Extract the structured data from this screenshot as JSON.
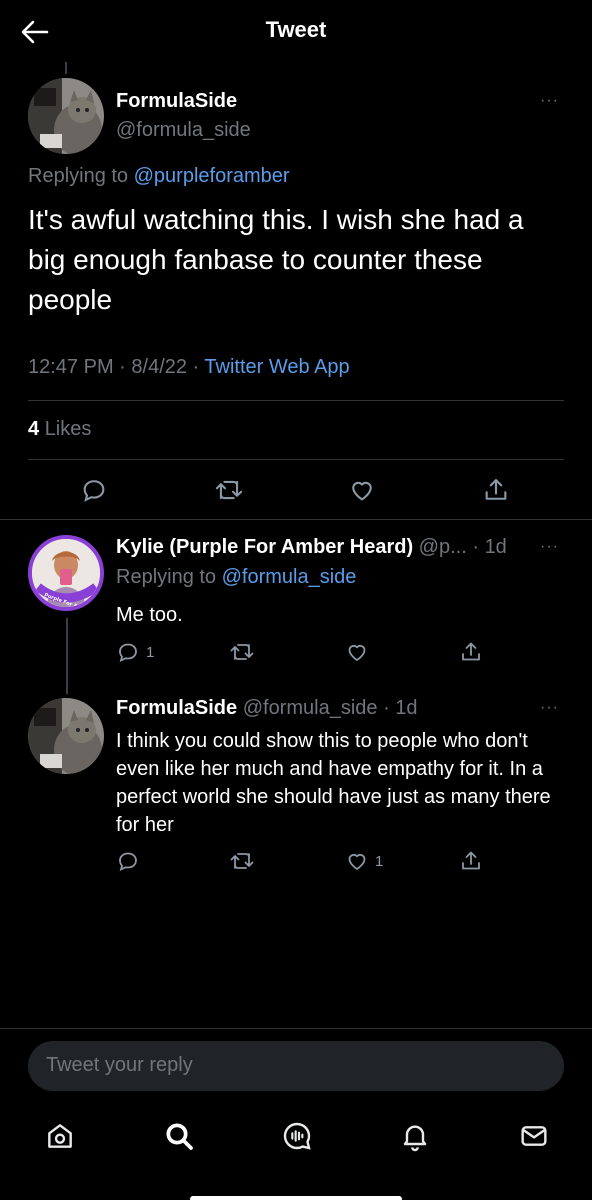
{
  "header": {
    "title": "Tweet"
  },
  "main_tweet": {
    "name": "FormulaSide",
    "handle": "@formula_side",
    "replying_label": "Replying to",
    "replying_to": "@purpleforamber",
    "text": "It's awful watching this. I wish she had a big enough fanbase to counter these people",
    "time": "12:47 PM",
    "date": "8/4/22",
    "source": "Twitter Web App",
    "likes_count": "4",
    "likes_label": "Likes",
    "more": "···"
  },
  "replies": [
    {
      "name": "Kylie (Purple For Amber Heard)",
      "handle": "@p...",
      "age": "1d",
      "replying_label": "Replying to",
      "replying_to": "@formula_side",
      "text": "Me too.",
      "reply_count": "1",
      "retweet_count": "",
      "like_count": "",
      "avatar_text": "Purple For Amber",
      "more": "···"
    },
    {
      "name": "FormulaSide",
      "handle": "@formula_side",
      "age": "1d",
      "text": "I think you could show this to people who don't even like her much and have empathy for it. In a perfect world she should have just as many there for her",
      "reply_count": "",
      "retweet_count": "",
      "like_count": "1",
      "more": "···"
    }
  ],
  "composer": {
    "placeholder": "Tweet your reply"
  },
  "nav": [
    "home-icon",
    "search-icon",
    "spaces-icon",
    "notifications-icon",
    "messages-icon"
  ],
  "colors": {
    "background": "#000000",
    "link": "#5a9de9",
    "muted": "#71767b",
    "accent_purple": "#8a3fd6"
  }
}
